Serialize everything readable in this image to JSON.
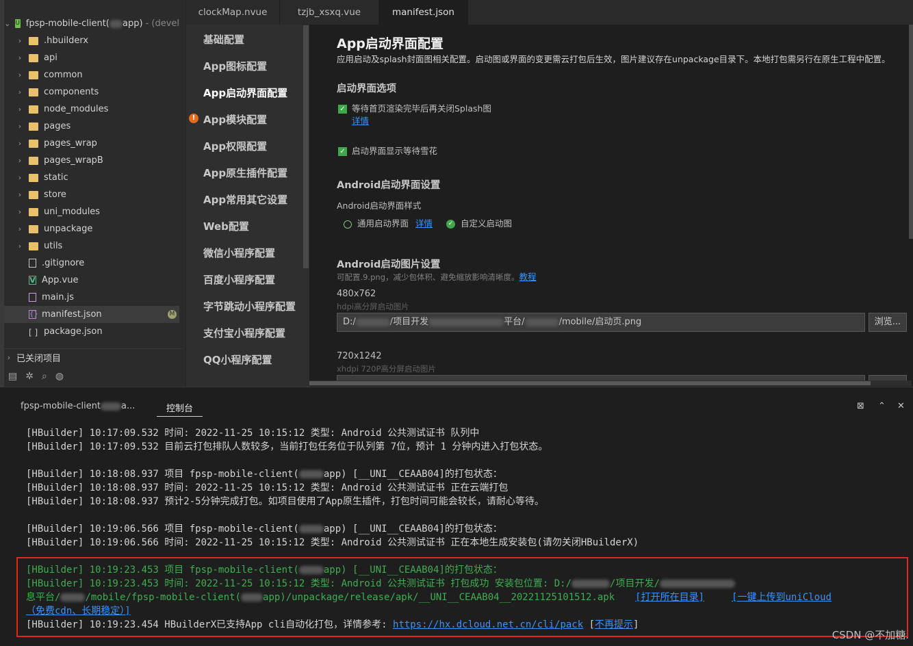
{
  "explorer": {
    "project": {
      "name": "fpsp-mobile-client(",
      "name_tail": "app)",
      "branch": "- (devel"
    },
    "items": [
      {
        "label": ".hbuilderx",
        "type": "folder"
      },
      {
        "label": "api",
        "type": "folder"
      },
      {
        "label": "common",
        "type": "folder"
      },
      {
        "label": "components",
        "type": "folder"
      },
      {
        "label": "node_modules",
        "type": "folder"
      },
      {
        "label": "pages",
        "type": "folder"
      },
      {
        "label": "pages_wrap",
        "type": "folder"
      },
      {
        "label": "pages_wrapB",
        "type": "folder"
      },
      {
        "label": "static",
        "type": "folder"
      },
      {
        "label": "store",
        "type": "folder"
      },
      {
        "label": "uni_modules",
        "type": "folder"
      },
      {
        "label": "unpackage",
        "type": "folder"
      },
      {
        "label": "utils",
        "type": "folder"
      },
      {
        "label": ".gitignore",
        "type": "file"
      },
      {
        "label": "App.vue",
        "type": "vue"
      },
      {
        "label": "main.js",
        "type": "js"
      },
      {
        "label": "manifest.json",
        "type": "json",
        "badge": "M"
      },
      {
        "label": "package.json",
        "type": "brk"
      }
    ],
    "closed_projects": "已关闭项目"
  },
  "tabs": [
    "clockMap.nvue",
    "tzjb_xsxq.vue",
    "manifest.json"
  ],
  "nav": [
    "基础配置",
    "App图标配置",
    "App启动界面配置",
    "App模块配置",
    "App权限配置",
    "App原生插件配置",
    "App常用其它设置",
    "Web配置",
    "微信小程序配置",
    "百度小程序配置",
    "字节跳动小程序配置",
    "支付宝小程序配置",
    "QQ小程序配置"
  ],
  "content": {
    "title": "App启动界面配置",
    "desc": "应用启动及splash封面图相关配置。启动图或界面的变更需云打包后生效，图片建议存在unpackage目录下。本地打包需另行在原生工程中配置。",
    "splash_options_title": "启动界面选项",
    "opt1": "等待首页渲染完毕后再关闭Splash图",
    "opt1_link": "详情",
    "opt2": "启动界面显示等待雪花",
    "android_title": "Android启动界面设置",
    "android_style_label": "Android启动界面样式",
    "radio1": "通用启动界面",
    "radio1_link": "详情",
    "radio2": "自定义启动图",
    "android_img_title": "Android启动图片设置",
    "android_img_note": "可配置.9.png，减少包体积、避免缩放影响清晰度。",
    "android_img_link": "教程",
    "res1": "480x762",
    "res1_sub": "hdpi高分屏启动图片",
    "path1_a": "D:/",
    "path1_b": "/项目开发",
    "path1_c": "平台/",
    "path1_d": "/mobile/启动页.png",
    "browse": "浏览...",
    "res2": "720x1242",
    "res2_sub": "xhdpi 720P高分屏启动图片"
  },
  "console": {
    "tab1": "fpsp-mobile-client",
    "tab1_tail": "a...",
    "tab2": "控制台",
    "lines": [
      "[HBuilder] 10:17:09.532 时间: 2022-11-25 10:15:12    类型: Android 公共测试证书    队列中",
      "[HBuilder] 10:17:09.532 目前云打包排队人数较多，当前打包任务位于队列第 7位，预计 1 分钟内进入打包状态。",
      "[HBuilder] 10:18:08.937 项目 fpsp-mobile-client(",
      "app) [__UNI__CEAAB04]的打包状态：",
      "[HBuilder] 10:18:08.937 时间: 2022-11-25 10:15:12    类型: Android 公共测试证书    正在云端打包",
      "[HBuilder] 10:18:08.937 预计2-5分钟完成打包。如项目使用了App原生插件，打包时间可能会较长，请耐心等待。",
      "[HBuilder] 10:19:06.566 项目 fpsp-mobile-client(",
      "app) [__UNI__CEAAB04]的打包状态：",
      "[HBuilder] 10:19:06.566 时间: 2022-11-25 10:15:12    类型: Android 公共测试证书    正在本地生成安装包(请勿关闭HBuilderX)",
      "[HBuilder] 10:19:23.453 项目 fpsp-mobile-client(",
      "app) [__UNI__CEAAB04]的打包状态：",
      "[HBuilder] 10:19:23.453 时间: 2022-11-25 10:15:12    类型: Android 公共测试证书    打包成功    安装包位置: D:/",
      "/项目开发/",
      "息平台/",
      "/mobile/fpsp-mobile-client(",
      "app)/unpackage/release/apk/__UNI__CEAAB04__20221125101512.apk",
      "[打开所在目录]",
      "[一键上传到uniCloud",
      "（免费cdn、长期稳定）]",
      "[HBuilder] 10:19:23.454 HBuilderX已支持App cli自动化打包，详情参考: ",
      "https://hx.dcloud.net.cn/cli/pack",
      "[",
      "不再提示",
      "]"
    ]
  },
  "watermark": "CSDN @不加糖."
}
